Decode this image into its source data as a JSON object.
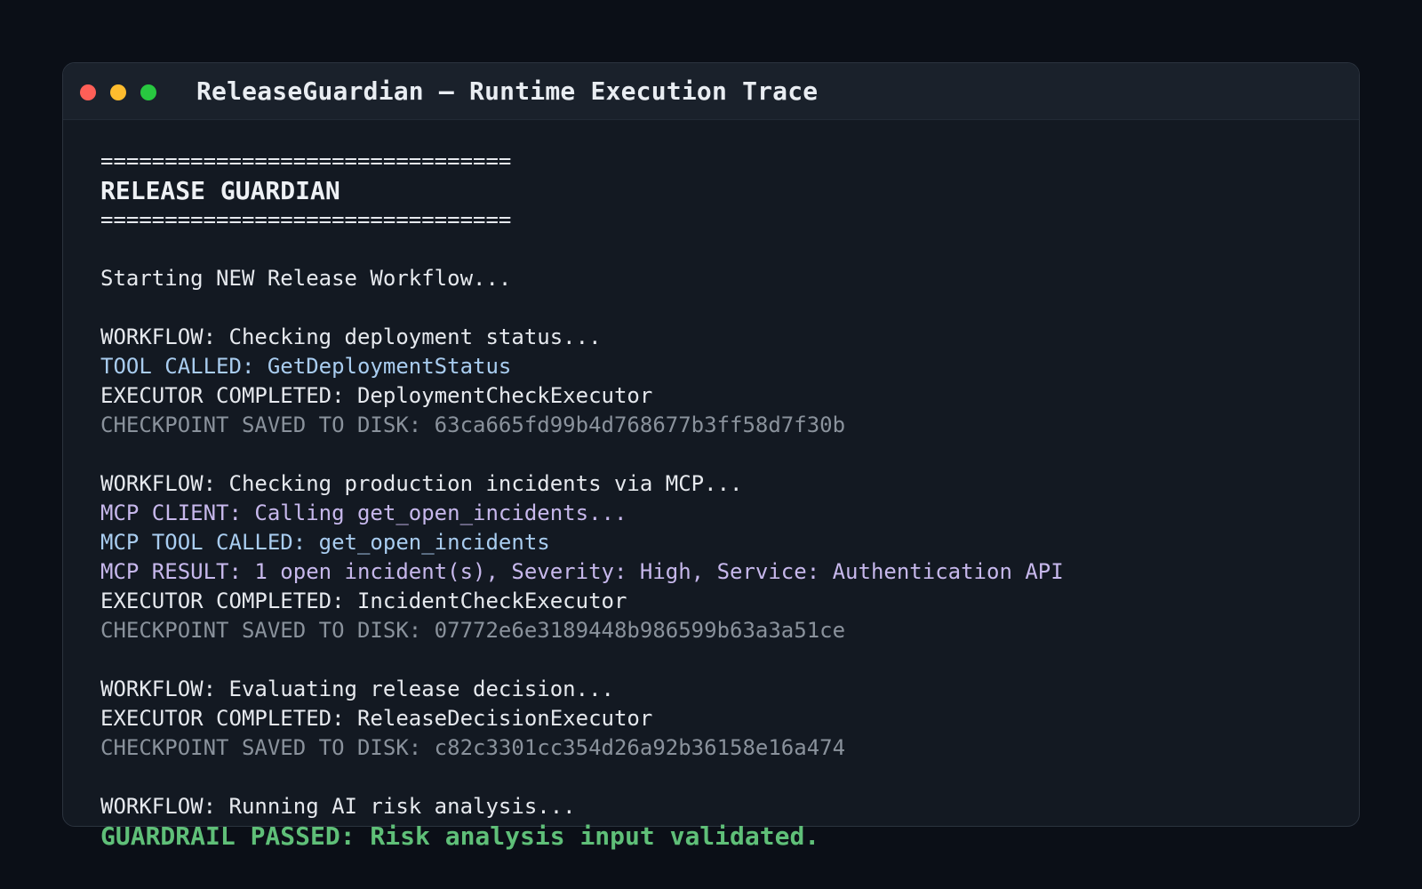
{
  "window": {
    "title": "ReleaseGuardian — Runtime Execution Trace"
  },
  "console": {
    "lines": [
      {
        "text": "================================",
        "style": "rule"
      },
      {
        "text": "RELEASE GUARDIAN",
        "style": "header"
      },
      {
        "text": "================================",
        "style": "rule"
      },
      {
        "text": "",
        "style": "blank"
      },
      {
        "text": "Starting NEW Release Workflow...",
        "style": "white"
      },
      {
        "text": "",
        "style": "blank"
      },
      {
        "text": "WORKFLOW: Checking deployment status...",
        "style": "white"
      },
      {
        "text": "TOOL CALLED: GetDeploymentStatus",
        "style": "tool"
      },
      {
        "text": "EXECUTOR COMPLETED: DeploymentCheckExecutor",
        "style": "white"
      },
      {
        "text": "CHECKPOINT SAVED TO DISK: 63ca665fd99b4d768677b3ff58d7f30b",
        "style": "checkpoint"
      },
      {
        "text": "",
        "style": "blank"
      },
      {
        "text": "WORKFLOW: Checking production incidents via MCP...",
        "style": "white"
      },
      {
        "text": "MCP CLIENT: Calling get_open_incidents...",
        "style": "mcp"
      },
      {
        "text": "MCP TOOL CALLED: get_open_incidents",
        "style": "tool"
      },
      {
        "text": "MCP RESULT: 1 open incident(s), Severity: High, Service: Authentication API",
        "style": "mcp"
      },
      {
        "text": "EXECUTOR COMPLETED: IncidentCheckExecutor",
        "style": "white"
      },
      {
        "text": "CHECKPOINT SAVED TO DISK: 07772e6e3189448b986599b63a3a51ce",
        "style": "checkpoint"
      },
      {
        "text": "",
        "style": "blank"
      },
      {
        "text": "WORKFLOW: Evaluating release decision...",
        "style": "white"
      },
      {
        "text": "EXECUTOR COMPLETED: ReleaseDecisionExecutor",
        "style": "white"
      },
      {
        "text": "CHECKPOINT SAVED TO DISK: c82c3301cc354d26a92b36158e16a474",
        "style": "checkpoint"
      },
      {
        "text": "",
        "style": "blank"
      },
      {
        "text": "WORKFLOW: Running AI risk analysis...",
        "style": "white"
      },
      {
        "text": "GUARDRAIL PASSED: Risk analysis input validated.",
        "style": "guardrail"
      }
    ]
  },
  "colors": {
    "background": "#0b0f17",
    "window": "#131922",
    "titlebar": "#1a212b",
    "text": "#e6e9ee",
    "tool": "#a9cdf0",
    "mcp": "#c7b8ec",
    "checkpoint": "#8a929c",
    "guardrail": "#5fbf78",
    "close": "#ff5f57",
    "minimize": "#febc2e",
    "zoom": "#28c840"
  }
}
